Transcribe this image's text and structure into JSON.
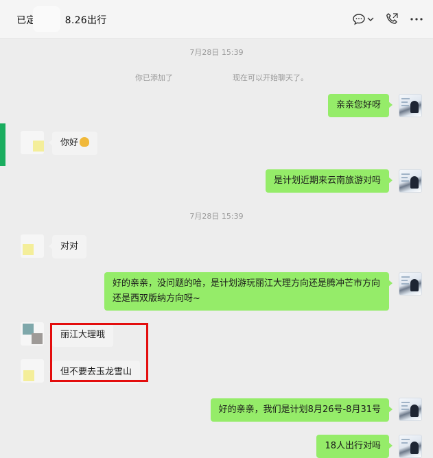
{
  "header": {
    "title_prefix": "已定",
    "title_suffix": "8.26出行",
    "icons": [
      "chat-bubble-icon",
      "chevron-down-icon",
      "phone-icon",
      "more-icon"
    ]
  },
  "messages": {
    "time1": "7月28日 15:39",
    "system_left": "你已添加了",
    "system_right": "现在可以开始聊天了。",
    "m1": "亲亲您好呀",
    "m2": "你好",
    "m3": "是计划近期来云南旅游对吗",
    "time2": "7月28日 15:39",
    "m4": "对对",
    "m5_line1": "好的亲亲，没问题的哈，是计划游玩丽江大理方向还是腾冲芒市方向",
    "m5_line2": "还是西双版纳方向呀~",
    "m6": "丽江大理哦",
    "m7": "但不要去玉龙雪山",
    "m8": "好的亲亲，我们是计划8月26号-8月31号",
    "m9": "18人出行对吗"
  },
  "colors": {
    "my_bubble": "#95ec69",
    "other_bubble": "#f3f3f3",
    "highlight": "#e30d0d",
    "active_tab": "#1aad5f"
  }
}
